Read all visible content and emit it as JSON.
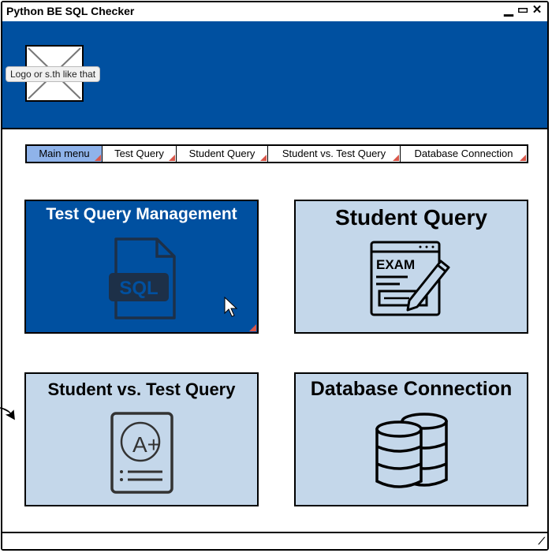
{
  "window": {
    "title": "Python BE SQL Checker"
  },
  "header": {
    "logo_label": "Logo or s.th like that"
  },
  "nav": {
    "tabs": [
      {
        "label": "Main menu",
        "active": true
      },
      {
        "label": "Test Query",
        "active": false
      },
      {
        "label": "Student Query",
        "active": false
      },
      {
        "label": "Student vs. Test Query",
        "active": false
      },
      {
        "label": "Database Connection",
        "active": false
      }
    ]
  },
  "cards": {
    "test_query_management": {
      "title": "Test Query Management",
      "icon": "sql-file-icon",
      "active": true
    },
    "student_query": {
      "title": "Student Query",
      "icon": "exam-pencil-icon",
      "exam_text": "EXAM"
    },
    "student_vs_test": {
      "title": "Student vs. Test Query",
      "icon": "graded-paper-icon",
      "grade": "A+"
    },
    "database_connection": {
      "title": "Database Connection",
      "icon": "database-icon"
    }
  },
  "colors": {
    "header_bg": "#0050A0",
    "active_card": "#0050A0",
    "card_bg": "#c4d7ea",
    "active_tab": "#8fb3ea",
    "marker": "#d9574a"
  }
}
